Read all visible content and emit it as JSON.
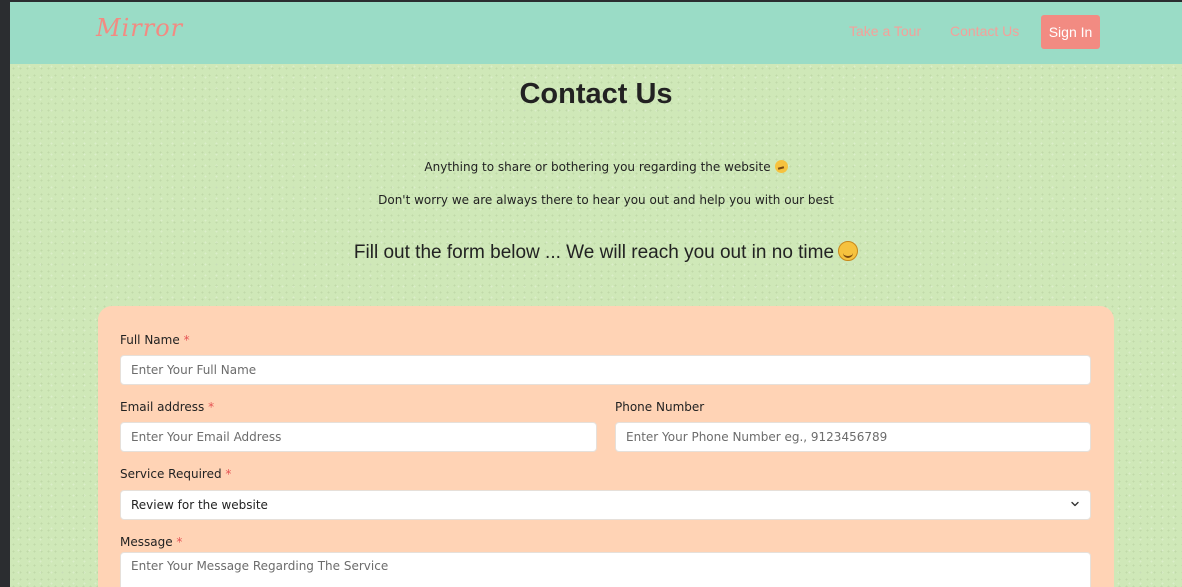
{
  "nav": {
    "brand": "Mirror",
    "links": [
      {
        "label": "Take a Tour"
      },
      {
        "label": "Contact Us"
      }
    ],
    "signin_label": "Sign In"
  },
  "header": {
    "title": "Contact Us",
    "line1": "Anything to share or bothering you regarding the website",
    "line2": "Don't worry we are always there to hear you out and help you with our best",
    "tagline": "Fill out the form below ... We will reach you out in no time"
  },
  "form": {
    "full_name": {
      "label": "Full Name",
      "required_mark": "*",
      "placeholder": "Enter Your Full Name"
    },
    "email": {
      "label": "Email address",
      "required_mark": "*",
      "placeholder": "Enter Your Email Address"
    },
    "phone": {
      "label": "Phone Number",
      "placeholder": "Enter Your Phone Number eg., 9123456789"
    },
    "service": {
      "label": "Service Required",
      "required_mark": "*",
      "value": "Review for the website"
    },
    "message": {
      "label": "Message",
      "required_mark": "*",
      "placeholder": "Enter Your Message Regarding The Service"
    }
  },
  "colors": {
    "navbar": "#9adcc6",
    "page_bg": "#cfe8b8",
    "accent": "#f28b82",
    "form_bg": "#ffd3b5",
    "required": "#e55353"
  },
  "icons": {
    "thinking": "thinking-face-icon",
    "smile": "smiling-face-icon",
    "select": "chevron-down-icon"
  }
}
